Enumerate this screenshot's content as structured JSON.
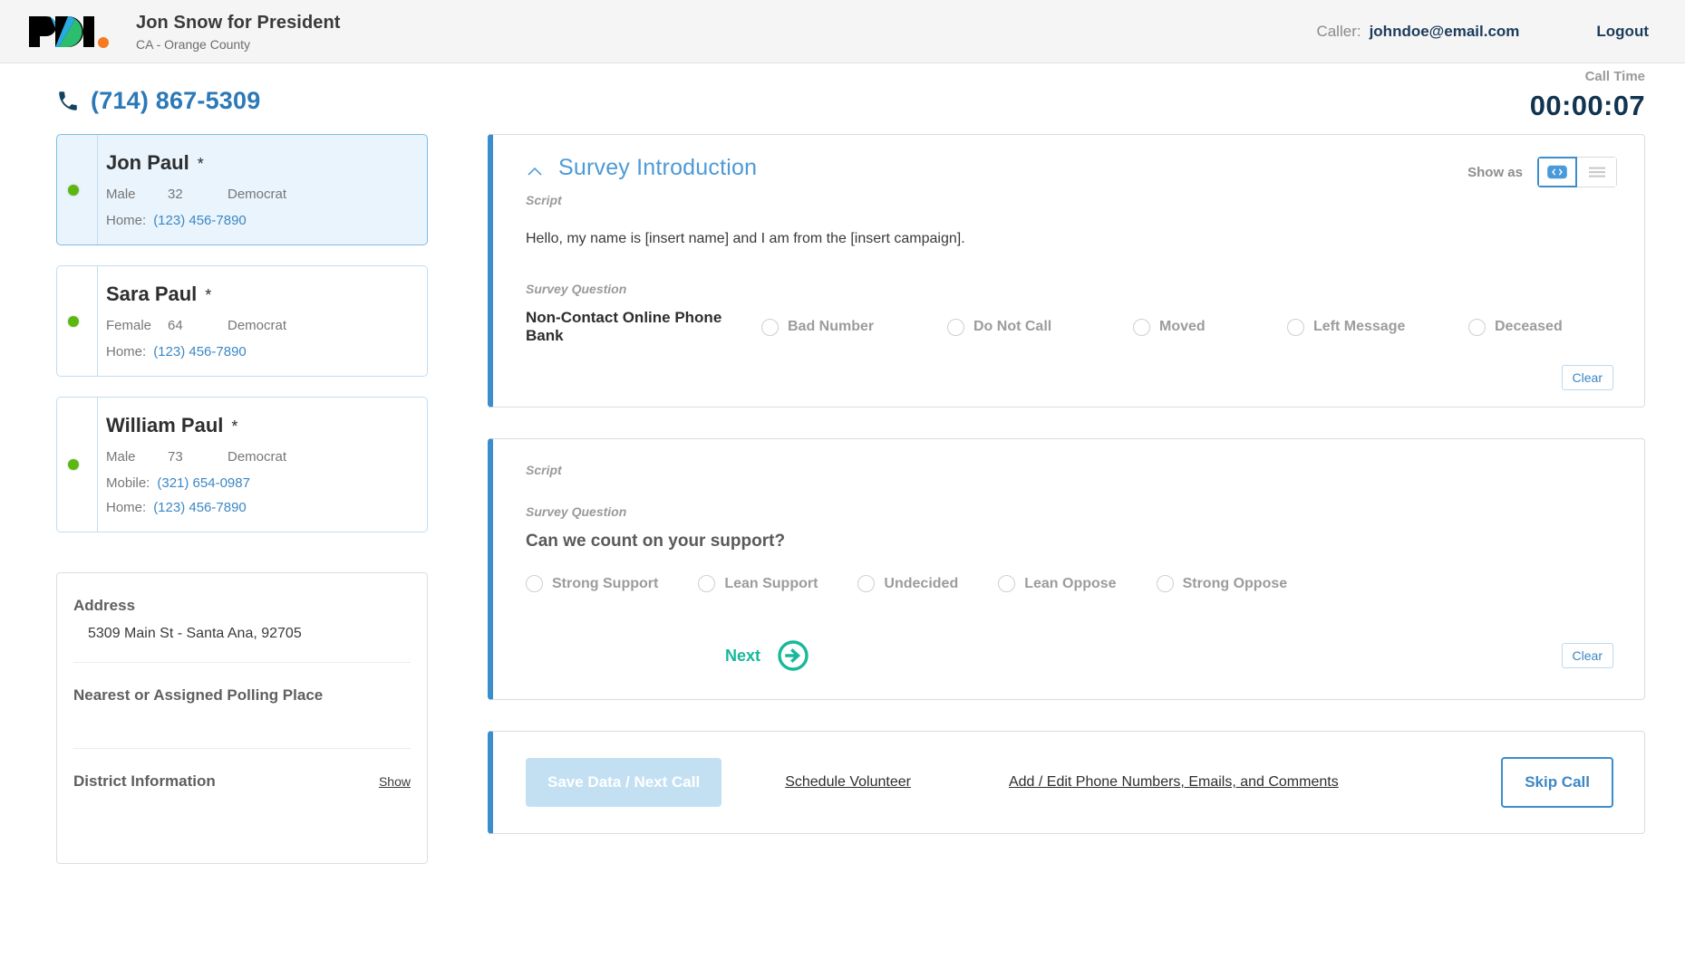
{
  "header": {
    "logo_text": "PDI.",
    "logo_name": "pdi-logo",
    "campaign_title": "Jon Snow for President",
    "campaign_location": "CA - Orange County",
    "caller_label": "Caller:",
    "caller_email": "johndoe@email.com",
    "logout_label": "Logout"
  },
  "call_bar": {
    "phone_number": "(714) 867-5309",
    "phone_icon": "phone-icon",
    "call_time_label": "Call Time",
    "call_time_value": "00:00:07"
  },
  "contacts": [
    {
      "name": "Jon Paul",
      "star": "*",
      "gender": "Male",
      "age": "32",
      "party": "Democrat",
      "selected": true,
      "phones": [
        {
          "label": "Home:",
          "number": "(123) 456-7890"
        }
      ]
    },
    {
      "name": "Sara Paul",
      "star": "*",
      "gender": "Female",
      "age": "64",
      "party": "Democrat",
      "selected": false,
      "phones": [
        {
          "label": "Home:",
          "number": "(123) 456-7890"
        }
      ]
    },
    {
      "name": "William Paul",
      "star": "*",
      "gender": "Male",
      "age": "73",
      "party": "Democrat",
      "selected": false,
      "phones": [
        {
          "label": "Mobile:",
          "number": "(321) 654-0987"
        },
        {
          "label": "Home:",
          "number": "(123) 456-7890"
        }
      ]
    }
  ],
  "address_panel": {
    "address_heading": "Address",
    "address_value": "5309 Main St - Santa Ana, 92705",
    "polling_heading": "Nearest or Assigned Polling Place",
    "district_heading": "District Information",
    "district_show_label": "Show"
  },
  "survey_intro": {
    "title": "Survey Introduction",
    "caret_icon": "chevron-up-icon",
    "show_as_label": "Show as",
    "toggle_card_icon": "card-view-icon",
    "toggle_list_icon": "list-view-icon",
    "script_label": "Script",
    "script_text": "Hello, my name is [insert name] and I am from the [insert campaign].",
    "question_label": "Survey Question",
    "question_title": "Non-Contact Online Phone Bank",
    "options": [
      "Bad Number",
      "Do Not Call",
      "Moved",
      "Left Message",
      "Deceased"
    ],
    "clear_label": "Clear"
  },
  "survey_support": {
    "script_label": "Script",
    "script_text": "",
    "question_label": "Survey Question",
    "question_title": "Can we count on your support?",
    "options": [
      "Strong Support",
      "Lean Support",
      "Undecided",
      "Lean Oppose",
      "Strong Oppose"
    ],
    "next_label": "Next",
    "next_icon": "arrow-circle-right-icon",
    "clear_label": "Clear"
  },
  "action_bar": {
    "save_label": "Save Data / Next Call",
    "schedule_label": "Schedule Volunteer",
    "add_edit_label": "Add / Edit Phone Numbers, Emails, and Comments",
    "skip_label": "Skip Call"
  },
  "colors": {
    "accent_blue": "#3c8dcc",
    "link_blue": "#2c79b8",
    "teal": "#17b89b",
    "status_green": "#5cb811",
    "header_bg": "#f5f5f5",
    "selected_card_bg": "#eaf4fc"
  }
}
